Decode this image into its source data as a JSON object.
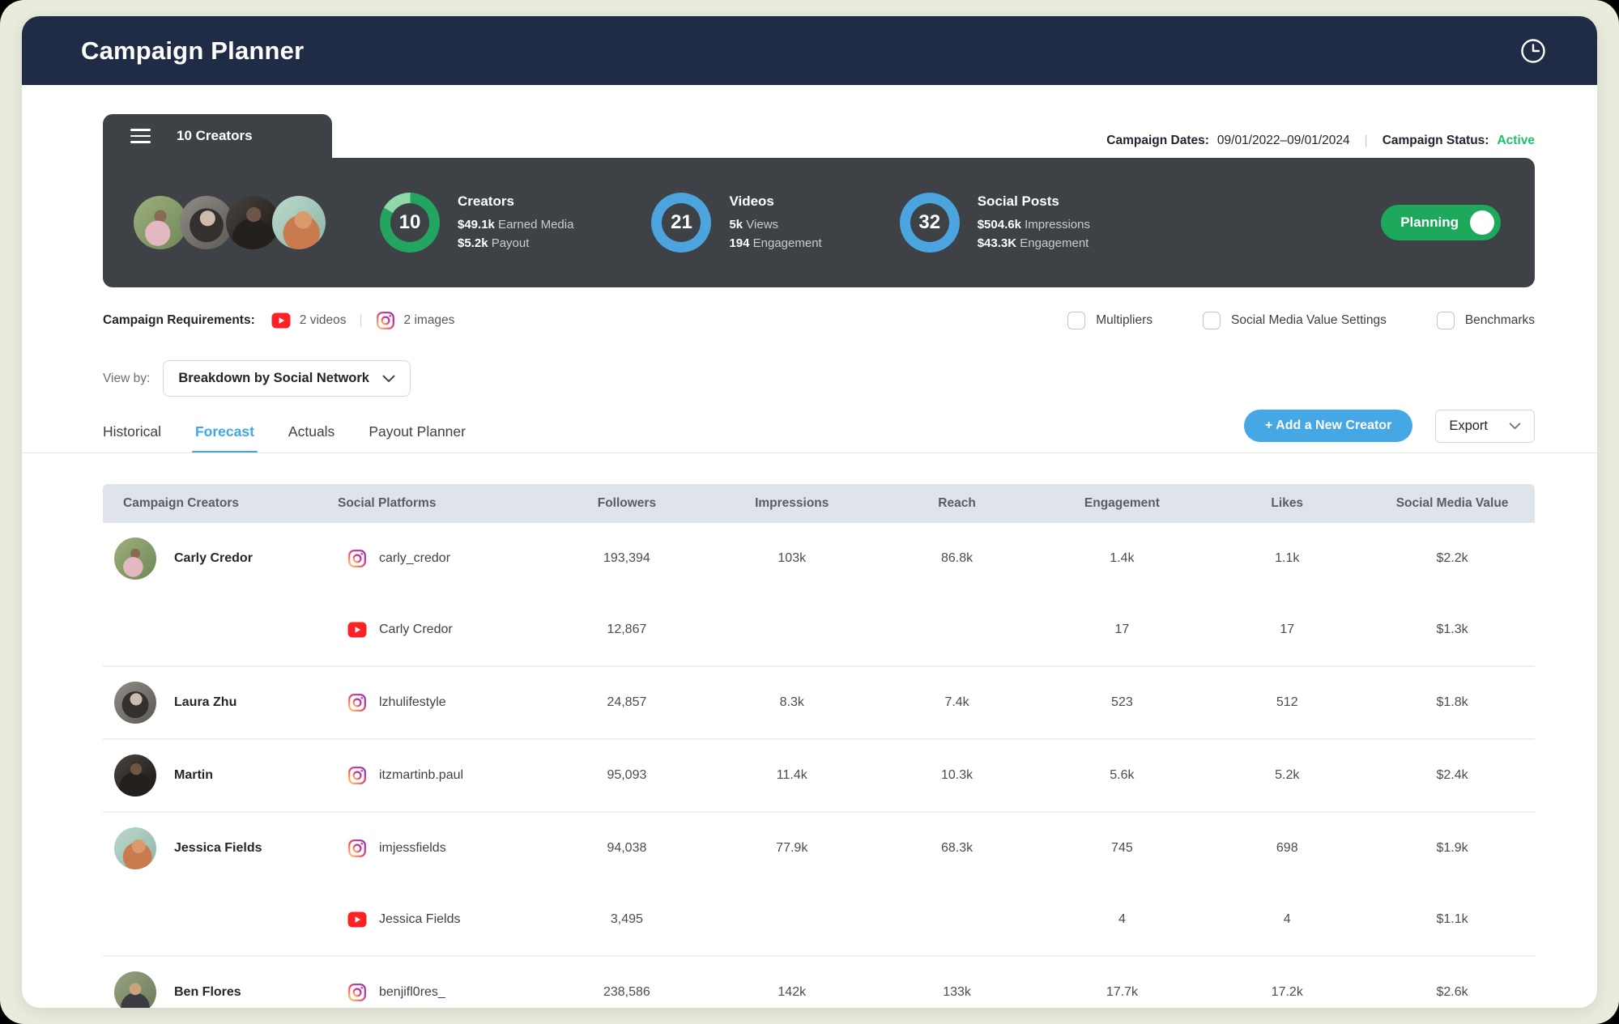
{
  "header": {
    "title": "Campaign Planner"
  },
  "campaign": {
    "creators_tab_label": "10 Creators",
    "dates_label": "Campaign Dates:",
    "dates_value": "09/01/2022–09/01/2024",
    "status_label": "Campaign Status:",
    "status_value": "Active",
    "avatars": [
      "carly",
      "laura",
      "martin",
      "jessica"
    ],
    "stats": [
      {
        "value": "10",
        "title": "Creators",
        "ring": "green",
        "line1_value": "$49.1k",
        "line1_label": "Earned Media",
        "line2_value": "$5.2k",
        "line2_label": "Payout"
      },
      {
        "value": "21",
        "title": "Videos",
        "ring": "blue",
        "line1_value": "5k",
        "line1_label": "Views",
        "line2_value": "194",
        "line2_label": "Engagement"
      },
      {
        "value": "32",
        "title": "Social Posts",
        "ring": "blue",
        "line1_value": "$504.6k",
        "line1_label": "Impressions",
        "line2_value": "$43.3K",
        "line2_label": "Engagement"
      }
    ],
    "toggle_label": "Planning"
  },
  "requirements": {
    "label": "Campaign Requirements:",
    "items": [
      {
        "icon": "youtube",
        "text": "2 videos"
      },
      {
        "icon": "instagram",
        "text": "2 images"
      }
    ],
    "checkboxes": [
      "Multipliers",
      "Social Media Value Settings",
      "Benchmarks"
    ]
  },
  "view_by": {
    "label": "View by:",
    "selected": "Breakdown by Social Network"
  },
  "tabs": {
    "items": [
      "Historical",
      "Forecast",
      "Actuals",
      "Payout Planner"
    ],
    "active": "Forecast",
    "active_index": 1
  },
  "actions": {
    "add_creator": "+ Add a New Creator",
    "export": "Export"
  },
  "table": {
    "columns": [
      "Campaign Creators",
      "Social Platforms",
      "Followers",
      "Impressions",
      "Reach",
      "Engagement",
      "Likes",
      "Social Media Value"
    ],
    "rows": [
      {
        "creator": "Carly Credor",
        "avatar": "carly",
        "platforms": [
          {
            "network": "instagram",
            "handle": "carly_credor",
            "followers": "193,394",
            "impressions": "103k",
            "reach": "86.8k",
            "engagement": "1.4k",
            "likes": "1.1k",
            "smv": "$2.2k"
          },
          {
            "network": "youtube",
            "handle": "Carly Credor",
            "followers": "12,867",
            "impressions": "",
            "reach": "",
            "engagement": "17",
            "likes": "17",
            "smv": "$1.3k"
          }
        ]
      },
      {
        "creator": "Laura Zhu",
        "avatar": "laura",
        "platforms": [
          {
            "network": "instagram",
            "handle": "lzhulifestyle",
            "followers": "24,857",
            "impressions": "8.3k",
            "reach": "7.4k",
            "engagement": "523",
            "likes": "512",
            "smv": "$1.8k"
          }
        ]
      },
      {
        "creator": "Martin",
        "avatar": "martin",
        "platforms": [
          {
            "network": "instagram",
            "handle": "itzmartinb.paul",
            "followers": "95,093",
            "impressions": "11.4k",
            "reach": "10.3k",
            "engagement": "5.6k",
            "likes": "5.2k",
            "smv": "$2.4k"
          }
        ]
      },
      {
        "creator": "Jessica Fields",
        "avatar": "jessica",
        "platforms": [
          {
            "network": "instagram",
            "handle": "imjessfields",
            "followers": "94,038",
            "impressions": "77.9k",
            "reach": "68.3k",
            "engagement": "745",
            "likes": "698",
            "smv": "$1.9k"
          },
          {
            "network": "youtube",
            "handle": "Jessica Fields",
            "followers": "3,495",
            "impressions": "",
            "reach": "",
            "engagement": "4",
            "likes": "4",
            "smv": "$1.1k"
          }
        ]
      },
      {
        "creator": "Ben Flores",
        "avatar": "ben",
        "platforms": [
          {
            "network": "instagram",
            "handle": "benjifl0res_",
            "followers": "238,586",
            "impressions": "142k",
            "reach": "133k",
            "engagement": "17.7k",
            "likes": "17.2k",
            "smv": "$2.6k"
          }
        ]
      }
    ]
  },
  "colors": {
    "header_navy": "#202B46",
    "panel_dark": "#3E4146",
    "accent_green": "#23A55F",
    "accent_green_light": "#8FD9A8",
    "accent_blue": "#4BA4DE",
    "button_blue": "#45A7E3",
    "tab_active_blue": "#3DA9E8",
    "status_active_green": "#1FC06B",
    "youtube_red": "#FC2125",
    "table_header_bg": "#DFE4EA",
    "page_background": "#E9ECDD"
  }
}
